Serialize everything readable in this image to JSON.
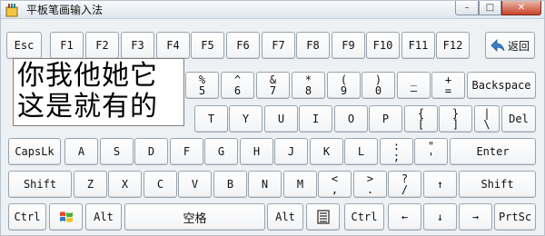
{
  "window": {
    "title": "平板笔画输入法"
  },
  "titlebar_buttons": {
    "minimize": "–",
    "maximize": "□",
    "close": "✕"
  },
  "candidates": {
    "line1": "你我他她它",
    "line2": "这是就有的"
  },
  "rows": {
    "r1": [
      "Esc",
      "F1",
      "F2",
      "F3",
      "F4",
      "F5",
      "F6",
      "F7",
      "F8",
      "F9",
      "F10",
      "F11",
      "F12"
    ],
    "back": "返回",
    "r2": [
      {
        "top": "%",
        "bottom": "5"
      },
      {
        "top": "^",
        "bottom": "6"
      },
      {
        "top": "&",
        "bottom": "7"
      },
      {
        "top": "*",
        "bottom": "8"
      },
      {
        "top": "(",
        "bottom": "9"
      },
      {
        "top": ")",
        "bottom": "0"
      },
      {
        "top": "_",
        "bottom": "—"
      },
      {
        "top": "+",
        "bottom": "="
      }
    ],
    "backspace": "Backspace",
    "r3": [
      "T",
      "Y",
      "U",
      "I",
      "O",
      "P"
    ],
    "r3_sym": [
      {
        "top": "{",
        "bottom": "["
      },
      {
        "top": "}",
        "bottom": "]"
      },
      {
        "top": "|",
        "bottom": "\\"
      }
    ],
    "del": "Del",
    "capslk": "CapsLk",
    "r4": [
      "A",
      "S",
      "D",
      "F",
      "G",
      "H",
      "J",
      "K",
      "L"
    ],
    "r4_sym": [
      {
        "top": ":",
        "bottom": ";"
      },
      {
        "top": "\"",
        "bottom": "'"
      }
    ],
    "enter": "Enter",
    "shift_left": "Shift",
    "r5": [
      "Z",
      "X",
      "C",
      "V",
      "B",
      "N",
      "M"
    ],
    "r5_sym": [
      {
        "top": "<",
        "bottom": ","
      },
      {
        "top": ">",
        "bottom": "."
      },
      {
        "top": "?",
        "bottom": "/"
      }
    ],
    "up_arrow": "↑",
    "shift_right": "Shift",
    "ctrl_left": "Ctrl",
    "alt_left": "Alt",
    "space": "空格",
    "alt_right": "Alt",
    "ctrl_right": "Ctrl",
    "left_arrow": "←",
    "down_arrow": "↓",
    "right_arrow": "→",
    "prtsc": "PrtSc"
  }
}
